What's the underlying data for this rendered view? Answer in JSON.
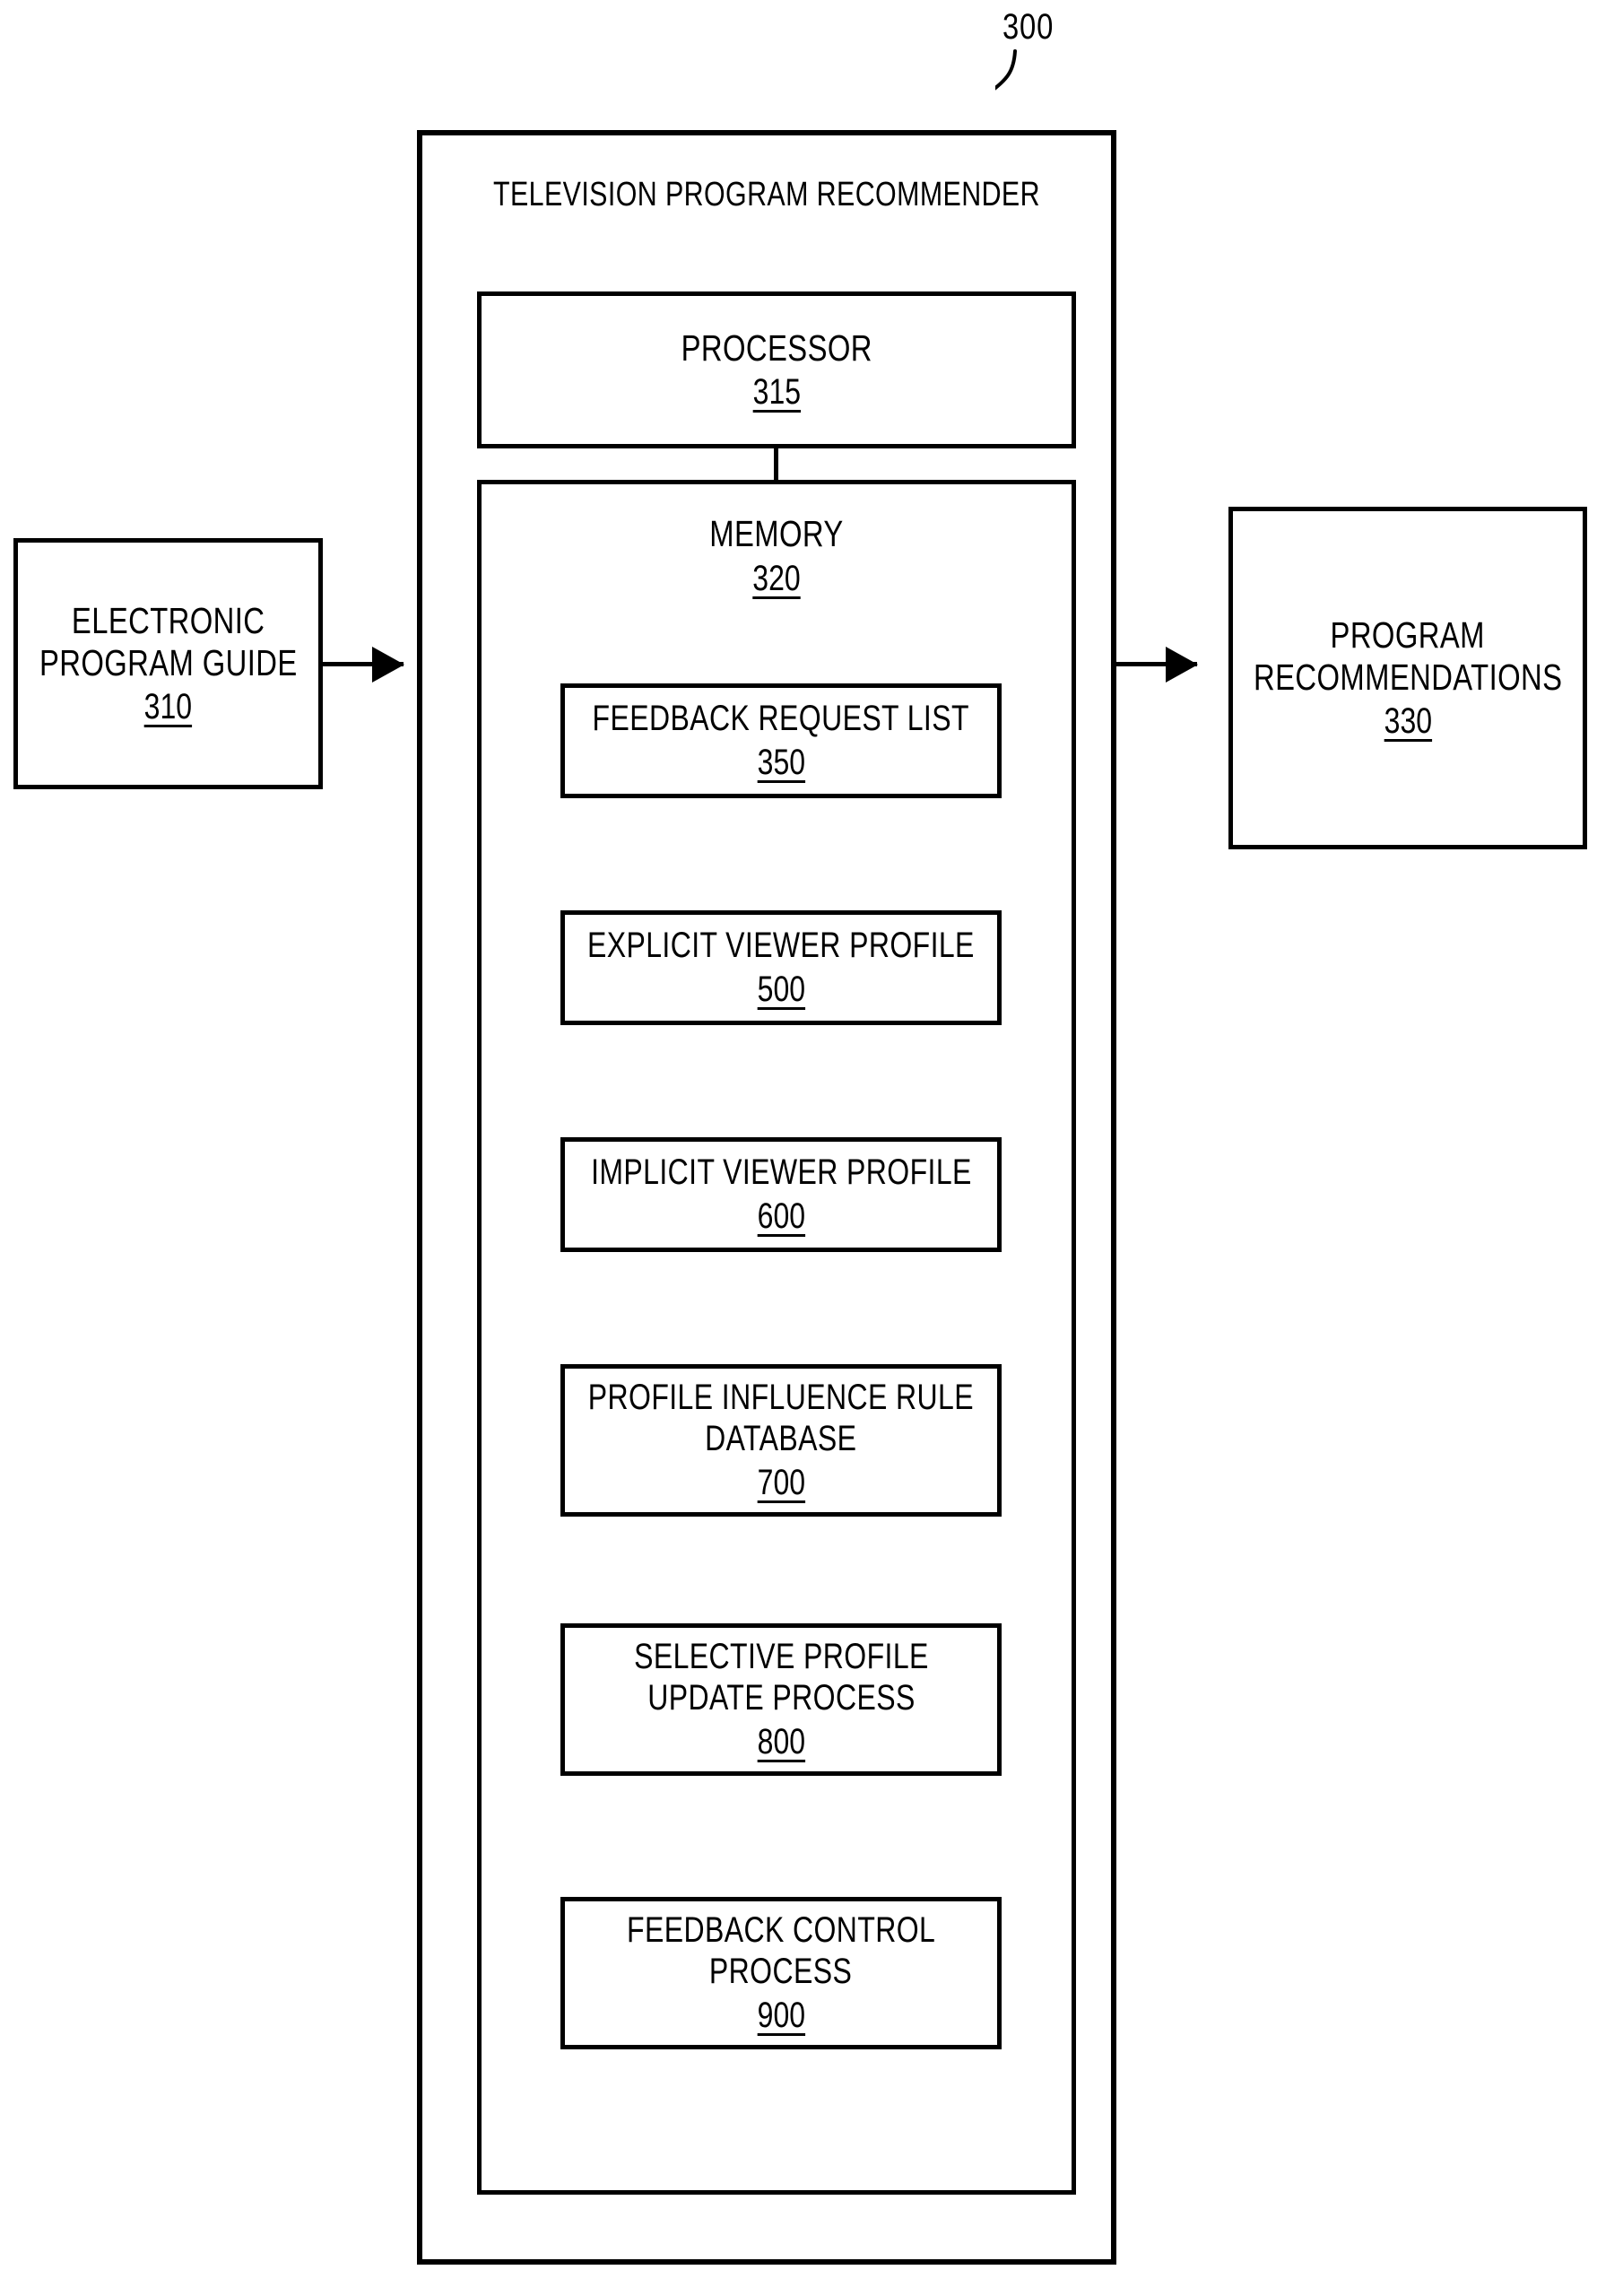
{
  "figure": {
    "leader_label": "300",
    "system": {
      "title": "TELEVISION PROGRAM RECOMMENDER",
      "processor": {
        "label": "PROCESSOR",
        "ref": "315"
      },
      "memory": {
        "label": "MEMORY",
        "ref": "320",
        "items": [
          {
            "line1": "FEEDBACK REQUEST LIST",
            "line2": "",
            "ref": "350"
          },
          {
            "line1": "EXPLICIT VIEWER PROFILE",
            "line2": "",
            "ref": "500"
          },
          {
            "line1": "IMPLICIT VIEWER PROFILE",
            "line2": "",
            "ref": "600"
          },
          {
            "line1": "PROFILE INFLUENCE RULE",
            "line2": "DATABASE",
            "ref": "700"
          },
          {
            "line1": "SELECTIVE PROFILE",
            "line2": "UPDATE PROCESS",
            "ref": "800"
          },
          {
            "line1": "FEEDBACK CONTROL",
            "line2": "PROCESS",
            "ref": "900"
          }
        ]
      }
    },
    "input": {
      "line1": "ELECTRONIC",
      "line2": "PROGRAM GUIDE",
      "ref": "310"
    },
    "output": {
      "line1": "PROGRAM",
      "line2": "RECOMMENDATIONS",
      "ref": "330"
    },
    "colors": {
      "ink": "#000000",
      "paper": "#ffffff"
    }
  }
}
